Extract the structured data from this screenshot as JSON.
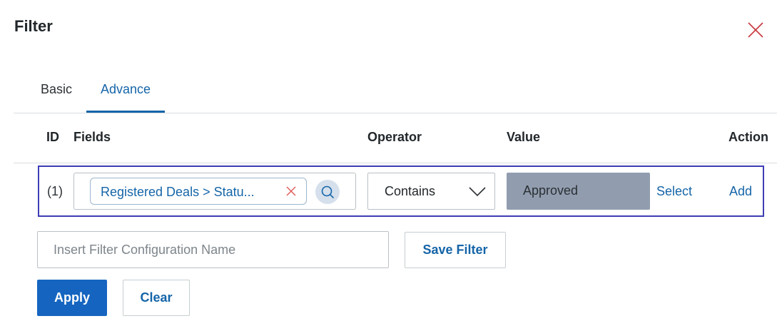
{
  "dialog": {
    "title": "Filter",
    "close_icon": "close-icon"
  },
  "tabs": [
    {
      "label": "Basic",
      "active": false
    },
    {
      "label": "Advance",
      "active": true
    }
  ],
  "table": {
    "headers": {
      "id": "ID",
      "fields": "Fields",
      "operator": "Operator",
      "value": "Value",
      "action": "Action"
    },
    "rows": [
      {
        "id": "(1)",
        "field_chip": "Registered Deals > Statu...",
        "operator": "Contains",
        "value": "Approved",
        "select_link": "Select",
        "add_link": "Add"
      }
    ]
  },
  "config": {
    "name_placeholder": "Insert Filter Configuration Name",
    "save_label": "Save Filter"
  },
  "footer": {
    "apply_label": "Apply",
    "clear_label": "Clear"
  },
  "colors": {
    "accent": "#1565a8",
    "primary_button": "#1565c0",
    "row_highlight_border": "#3d3db5",
    "value_background": "#919daf",
    "close_icon": "#c8373d"
  }
}
